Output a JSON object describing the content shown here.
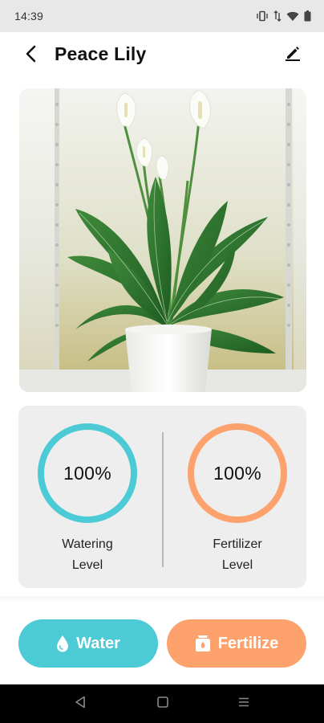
{
  "status_bar": {
    "time": "14:39",
    "icons": [
      "vibrate-icon",
      "data-arrows-icon",
      "wifi-icon",
      "battery-icon"
    ]
  },
  "app_bar": {
    "title": "Peace Lily",
    "back_icon": "back-arrow-icon",
    "edit_icon": "pencil-icon"
  },
  "photo": {
    "subject": "plant-photo"
  },
  "levels": {
    "watering": {
      "value": "100%",
      "fraction": 1.0,
      "label_line1": "Watering",
      "label_line2": "Level",
      "color": "#4ccad6"
    },
    "fertilizer": {
      "value": "100%",
      "fraction": 1.0,
      "label_line1": "Fertilizer",
      "label_line2": "Level",
      "color": "#fda26c"
    }
  },
  "actions": {
    "water_label": "Water",
    "water_icon": "water-drop-icon",
    "fertilize_label": "Fertilize",
    "fertilize_icon": "fertilizer-bag-icon"
  },
  "nav_bar": {
    "icons": [
      "nav-back-icon",
      "nav-home-icon",
      "nav-recents-icon"
    ]
  }
}
